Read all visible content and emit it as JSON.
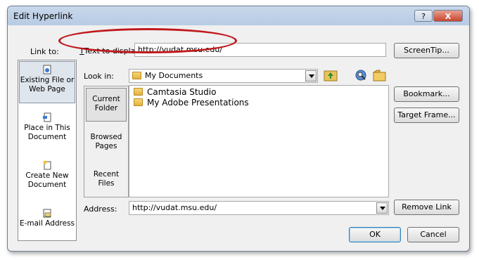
{
  "window": {
    "title": "Edit Hyperlink",
    "help_glyph": "?",
    "close_glyph": "X"
  },
  "labels": {
    "link_to": "Link to:",
    "text_to_display": "Text to display:",
    "look_in": "Look in:",
    "address": "Address:"
  },
  "fields": {
    "text_to_display_value": "http://vudat.msu.edu/",
    "look_in_value": "My Documents",
    "address_value": "http://vudat.msu.edu/"
  },
  "link_to_items": [
    {
      "line1": "Existing File or",
      "line2": "Web Page",
      "icon": "web-page-icon"
    },
    {
      "line1": "Place in This",
      "line2": "Document",
      "icon": "document-place-icon"
    },
    {
      "line1": "Create New",
      "line2": "Document",
      "icon": "new-document-icon"
    },
    {
      "line1": "E-mail Address",
      "line2": "",
      "icon": "email-icon"
    }
  ],
  "mid_tabs": [
    {
      "line1": "Current",
      "line2": "Folder"
    },
    {
      "line1": "Browsed",
      "line2": "Pages"
    },
    {
      "line1": "Recent",
      "line2": "Files"
    }
  ],
  "files": [
    {
      "name": "Camtasia Studio"
    },
    {
      "name": "My Adobe Presentations"
    }
  ],
  "buttons": {
    "screentip": "ScreenTip...",
    "bookmark": "Bookmark...",
    "target_frame": "Target Frame...",
    "remove_link": "Remove Link",
    "ok": "OK",
    "cancel": "Cancel"
  },
  "colors": {
    "annotation_oval": "#c0181c",
    "titlebar": "#c9d8ea"
  }
}
